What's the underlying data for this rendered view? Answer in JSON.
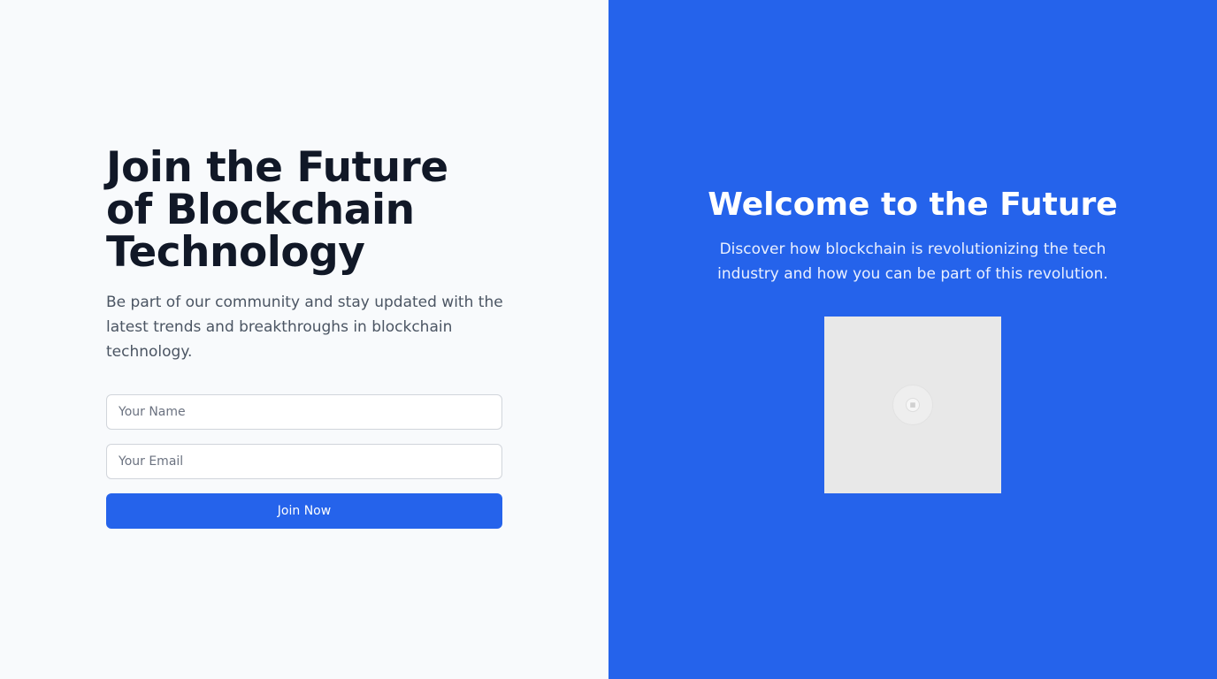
{
  "left": {
    "title": "Join the Future of Blockchain Technology",
    "subtitle": "Be part of our community and stay updated with the latest trends and breakthroughs in blockchain technology.",
    "form": {
      "name_placeholder": "Your Name",
      "name_value": "",
      "email_placeholder": "Your Email",
      "email_value": "",
      "submit_label": "Join Now"
    }
  },
  "right": {
    "title": "Welcome to the Future",
    "subtitle": "Discover how blockchain is revolutionizing the tech industry and how you can be part of this revolution.",
    "image_icon": "broken-image-icon"
  },
  "colors": {
    "left_background": "#f8fafc",
    "right_background": "#2563eb",
    "accent": "#2563eb",
    "title_text": "#111827",
    "body_text": "#4b5563"
  }
}
